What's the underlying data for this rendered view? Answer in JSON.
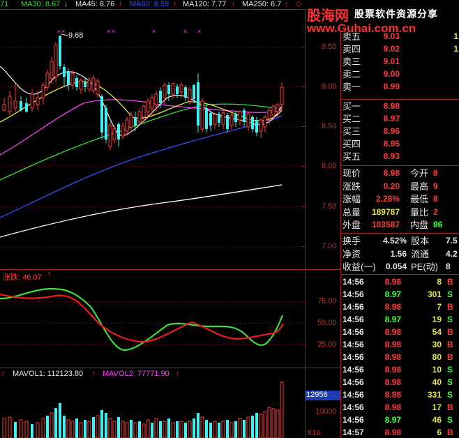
{
  "colors": {
    "background": "#000000",
    "axis_red": "#a01e1e",
    "up_red": "#ff3c3c",
    "down_cyan": "#40f0f0",
    "ma5": "#e6e6e6",
    "ma10": "#e6e640",
    "ma20": "#ff40ff",
    "ma30": "#30e030",
    "ma60": "#3050ff",
    "ma120": "#ffffff"
  },
  "indicator_bar": {
    "lead": "71",
    "ma30": "MA30: 8.67",
    "ma45": "MA45: 8.76",
    "ma60": "MA60: 8.59",
    "ma120": "MA120: 7.77",
    "ma250": "MA250: 6.7"
  },
  "watermark": {
    "site_name": "股海网",
    "slogan": "股票软件资源分享",
    "url": "www.Guhai.com.cn"
  },
  "price_chart": {
    "high_marker": "9.68",
    "y_axis": [
      "9.50",
      "9.00",
      "8.50",
      "8.00",
      "7.50",
      "7.00"
    ]
  },
  "indicator_chart": {
    "title": "涨跌: 46.07",
    "y_axis": [
      "75.00",
      "50.00",
      "25.00"
    ]
  },
  "volume_chart": {
    "mavol1": "MAVOL1: 112123.80",
    "mavol2": "MAVOL2: 77771.90",
    "badge": "12956",
    "y_axis": [
      "10000"
    ],
    "unit": "X10"
  },
  "order_book": {
    "asks": [
      {
        "label": "卖五",
        "price": "9.03",
        "vol": "1"
      },
      {
        "label": "卖四",
        "price": "9.02",
        "vol": "1"
      },
      {
        "label": "卖三",
        "price": "9.01",
        "vol": ""
      },
      {
        "label": "卖二",
        "price": "9.00",
        "vol": ""
      },
      {
        "label": "卖一",
        "price": "8.99",
        "vol": ""
      }
    ],
    "bids": [
      {
        "label": "买一",
        "price": "8.98",
        "vol": ""
      },
      {
        "label": "买二",
        "price": "8.97",
        "vol": ""
      },
      {
        "label": "买三",
        "price": "8.96",
        "vol": ""
      },
      {
        "label": "买四",
        "price": "8.95",
        "vol": ""
      },
      {
        "label": "买五",
        "price": "8.93",
        "vol": ""
      }
    ]
  },
  "stats": [
    {
      "l1": "现价",
      "v1": "8.98",
      "l2": "今开",
      "v2": "8",
      "c1": "red",
      "c2": "red"
    },
    {
      "l1": "涨跌",
      "v1": "0.20",
      "l2": "最高",
      "v2": "9",
      "c1": "red",
      "c2": "red"
    },
    {
      "l1": "涨幅",
      "v1": "2.28%",
      "l2": "最低",
      "v2": "8",
      "c1": "red",
      "c2": "red"
    },
    {
      "l1": "总量",
      "v1": "189787",
      "l2": "量比",
      "v2": "2",
      "c1": "yellow",
      "c2": "red"
    },
    {
      "l1": "外盘",
      "v1": "103587",
      "l2": "内盘",
      "v2": "86",
      "c1": "red",
      "c2": "green"
    }
  ],
  "stats2": [
    {
      "l1": "换手",
      "v1": "4.52%",
      "l2": "股本",
      "v2": "7.5"
    },
    {
      "l1": "净资",
      "v1": "1.56",
      "l2": "流通",
      "v2": "4.2"
    },
    {
      "l1": "收益(一)",
      "v1": "0.054",
      "l2": "PE(动)",
      "v2": "8"
    }
  ],
  "ticks": [
    {
      "time": "14:56",
      "price": "8.98",
      "vol": "8",
      "side": "B"
    },
    {
      "time": "14:56",
      "price": "8.97",
      "vol": "301",
      "side": "S"
    },
    {
      "time": "14:56",
      "price": "8.98",
      "vol": "7",
      "side": "B"
    },
    {
      "time": "14:56",
      "price": "8.97",
      "vol": "19",
      "side": "S"
    },
    {
      "time": "14:56",
      "price": "8.98",
      "vol": "54",
      "side": "B"
    },
    {
      "time": "14:56",
      "price": "8.98",
      "vol": "30",
      "side": "B"
    },
    {
      "time": "14:56",
      "price": "8.98",
      "vol": "80",
      "side": "B"
    },
    {
      "time": "14:56",
      "price": "8.98",
      "vol": "10",
      "side": "S"
    },
    {
      "time": "14:56",
      "price": "8.98",
      "vol": "40",
      "side": "S"
    },
    {
      "time": "14:56",
      "price": "8.98",
      "vol": "331",
      "side": "S"
    },
    {
      "time": "14:56",
      "price": "8.98",
      "vol": "17",
      "side": "B"
    },
    {
      "time": "14:56",
      "price": "8.97",
      "vol": "46",
      "side": "S"
    },
    {
      "time": "14:57",
      "price": "8.98",
      "vol": "6",
      "side": "B"
    }
  ]
}
